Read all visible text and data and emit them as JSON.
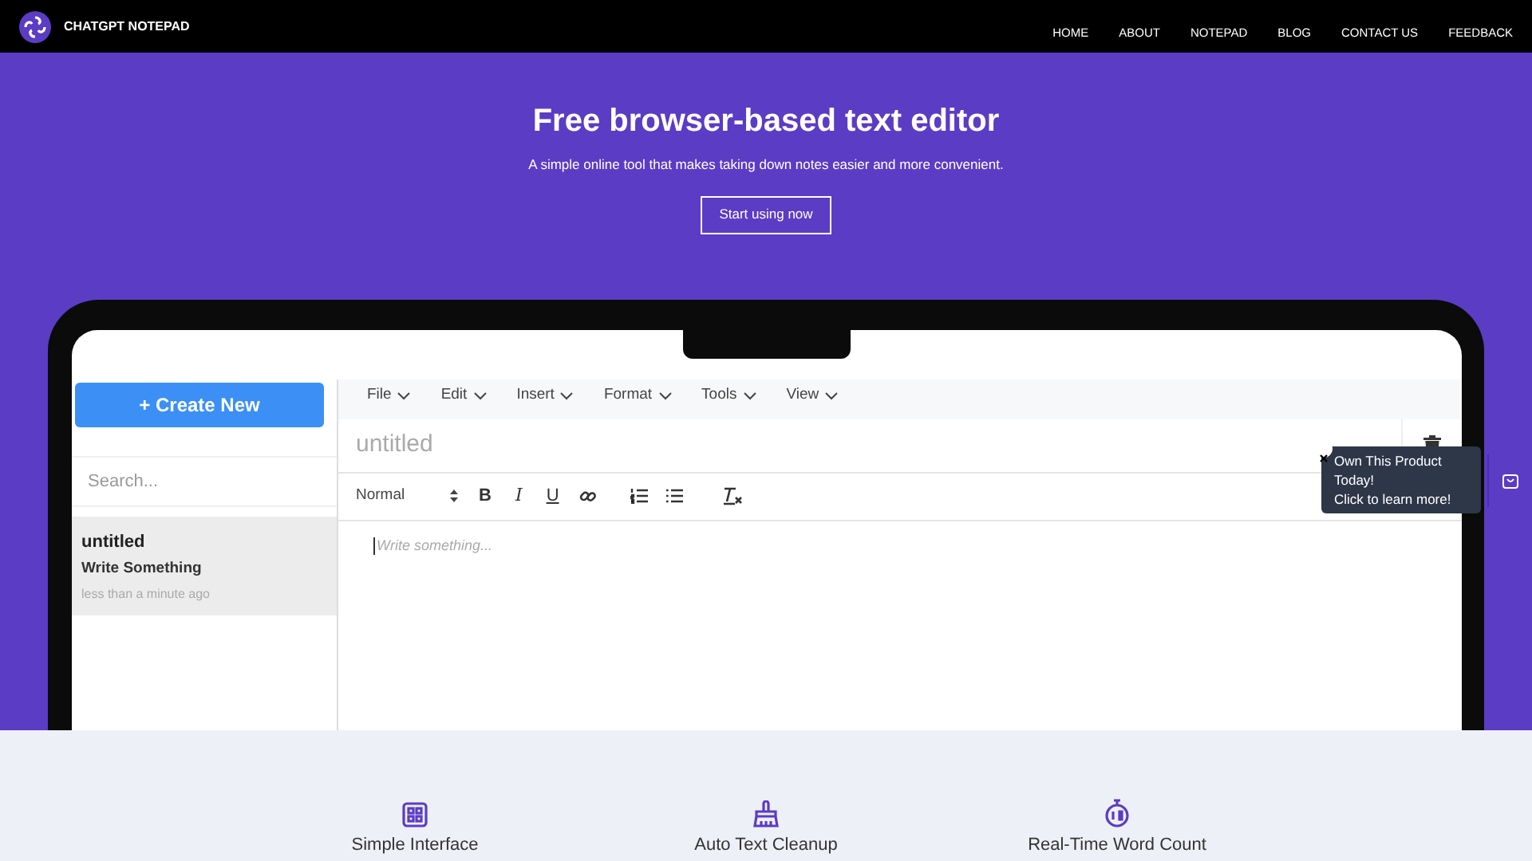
{
  "navbar": {
    "brand": "CHATGPT NOTEPAD",
    "links": [
      "HOME",
      "ABOUT",
      "NOTEPAD",
      "BLOG",
      "CONTACT US",
      "FEEDBACK"
    ]
  },
  "hero": {
    "title": "Free browser-based text editor",
    "subtitle": "A simple online tool that makes taking down notes easier and more convenient.",
    "button": "Start using now"
  },
  "editor": {
    "create_button": "+ Create New",
    "search": {
      "placeholder": "Search..."
    },
    "notes": [
      {
        "title": "untitled",
        "preview": "Write Something",
        "time": "less than a minute ago",
        "selected": true
      }
    ],
    "menu": [
      "File",
      "Edit",
      "Insert",
      "Format",
      "Tools",
      "View"
    ],
    "document_title": {
      "placeholder": "untitled"
    },
    "toolbar": {
      "format": "Normal",
      "buttons": [
        {
          "kind": "bold",
          "label": "B"
        },
        {
          "kind": "italic",
          "label": "I"
        },
        {
          "kind": "underline",
          "label": "U"
        }
      ]
    },
    "body": {
      "placeholder": "Write something..."
    }
  },
  "promo_popup": {
    "lines": [
      "Own This Product",
      "Today!",
      "Click to learn more!"
    ]
  },
  "features": [
    {
      "kind": "grid",
      "title": "Simple Interface"
    },
    {
      "kind": "brush",
      "title": "Auto Text Cleanup"
    },
    {
      "kind": "timer",
      "title": "Real-Time Word Count"
    }
  ]
}
